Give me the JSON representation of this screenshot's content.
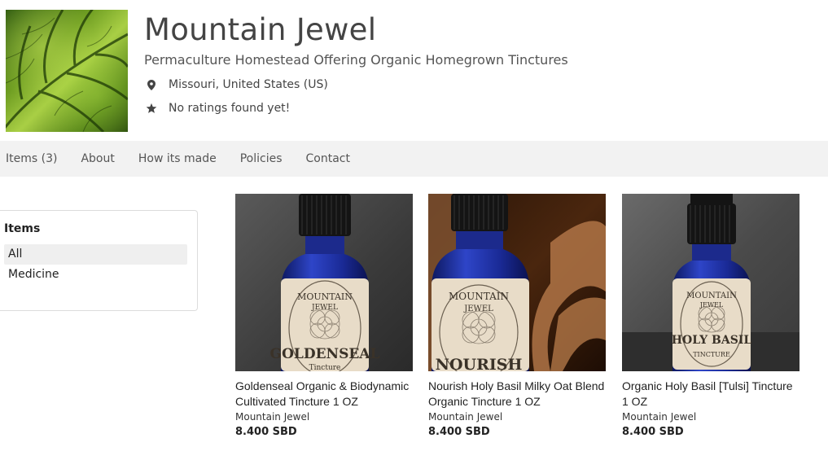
{
  "shop": {
    "name": "Mountain Jewel",
    "tagline": "Permaculture Homestead Offering Organic Homegrown Tinctures",
    "location": "Missouri, United States (US)",
    "rating_text": "No ratings found yet!",
    "location_icon": "map-pin-icon",
    "rating_icon": "star-icon"
  },
  "nav": {
    "items": [
      "Items (3)",
      "About",
      "How its made",
      "Policies",
      "Contact"
    ]
  },
  "sidebar": {
    "title": "Items",
    "items": [
      "All",
      "Medicine"
    ],
    "active": "All"
  },
  "products": [
    {
      "title": "Goldenseal Organic & Biodynamic Cultivated Tincture 1 OZ",
      "seller": "Mountain Jewel",
      "price": "8.400 SBD",
      "label_top": "MOUNTAIN",
      "label_mid": "JEWEL",
      "label_main": "GOLDENSEAL",
      "label_sub": "Tincture"
    },
    {
      "title": "Nourish Holy Basil Milky Oat Blend Organic Tincture 1 OZ",
      "seller": "Mountain Jewel",
      "price": "8.400 SBD",
      "label_top": "MOUNTAIN",
      "label_mid": "JEWEL",
      "label_main": "NOURISH",
      "label_sub": ""
    },
    {
      "title": "Organic Holy Basil [Tulsi] Tincture 1 OZ",
      "seller": "Mountain Jewel",
      "price": "8.400 SBD",
      "label_top": "MOUNTAIN",
      "label_mid": "JEWEL",
      "label_main": "HOLY BASIL",
      "label_sub": "TINCTURE"
    }
  ],
  "colors": {
    "nav_bg": "#f2f2f2",
    "bottle_blue": "#1c2a8c",
    "label_paper": "#e8dcc8"
  }
}
